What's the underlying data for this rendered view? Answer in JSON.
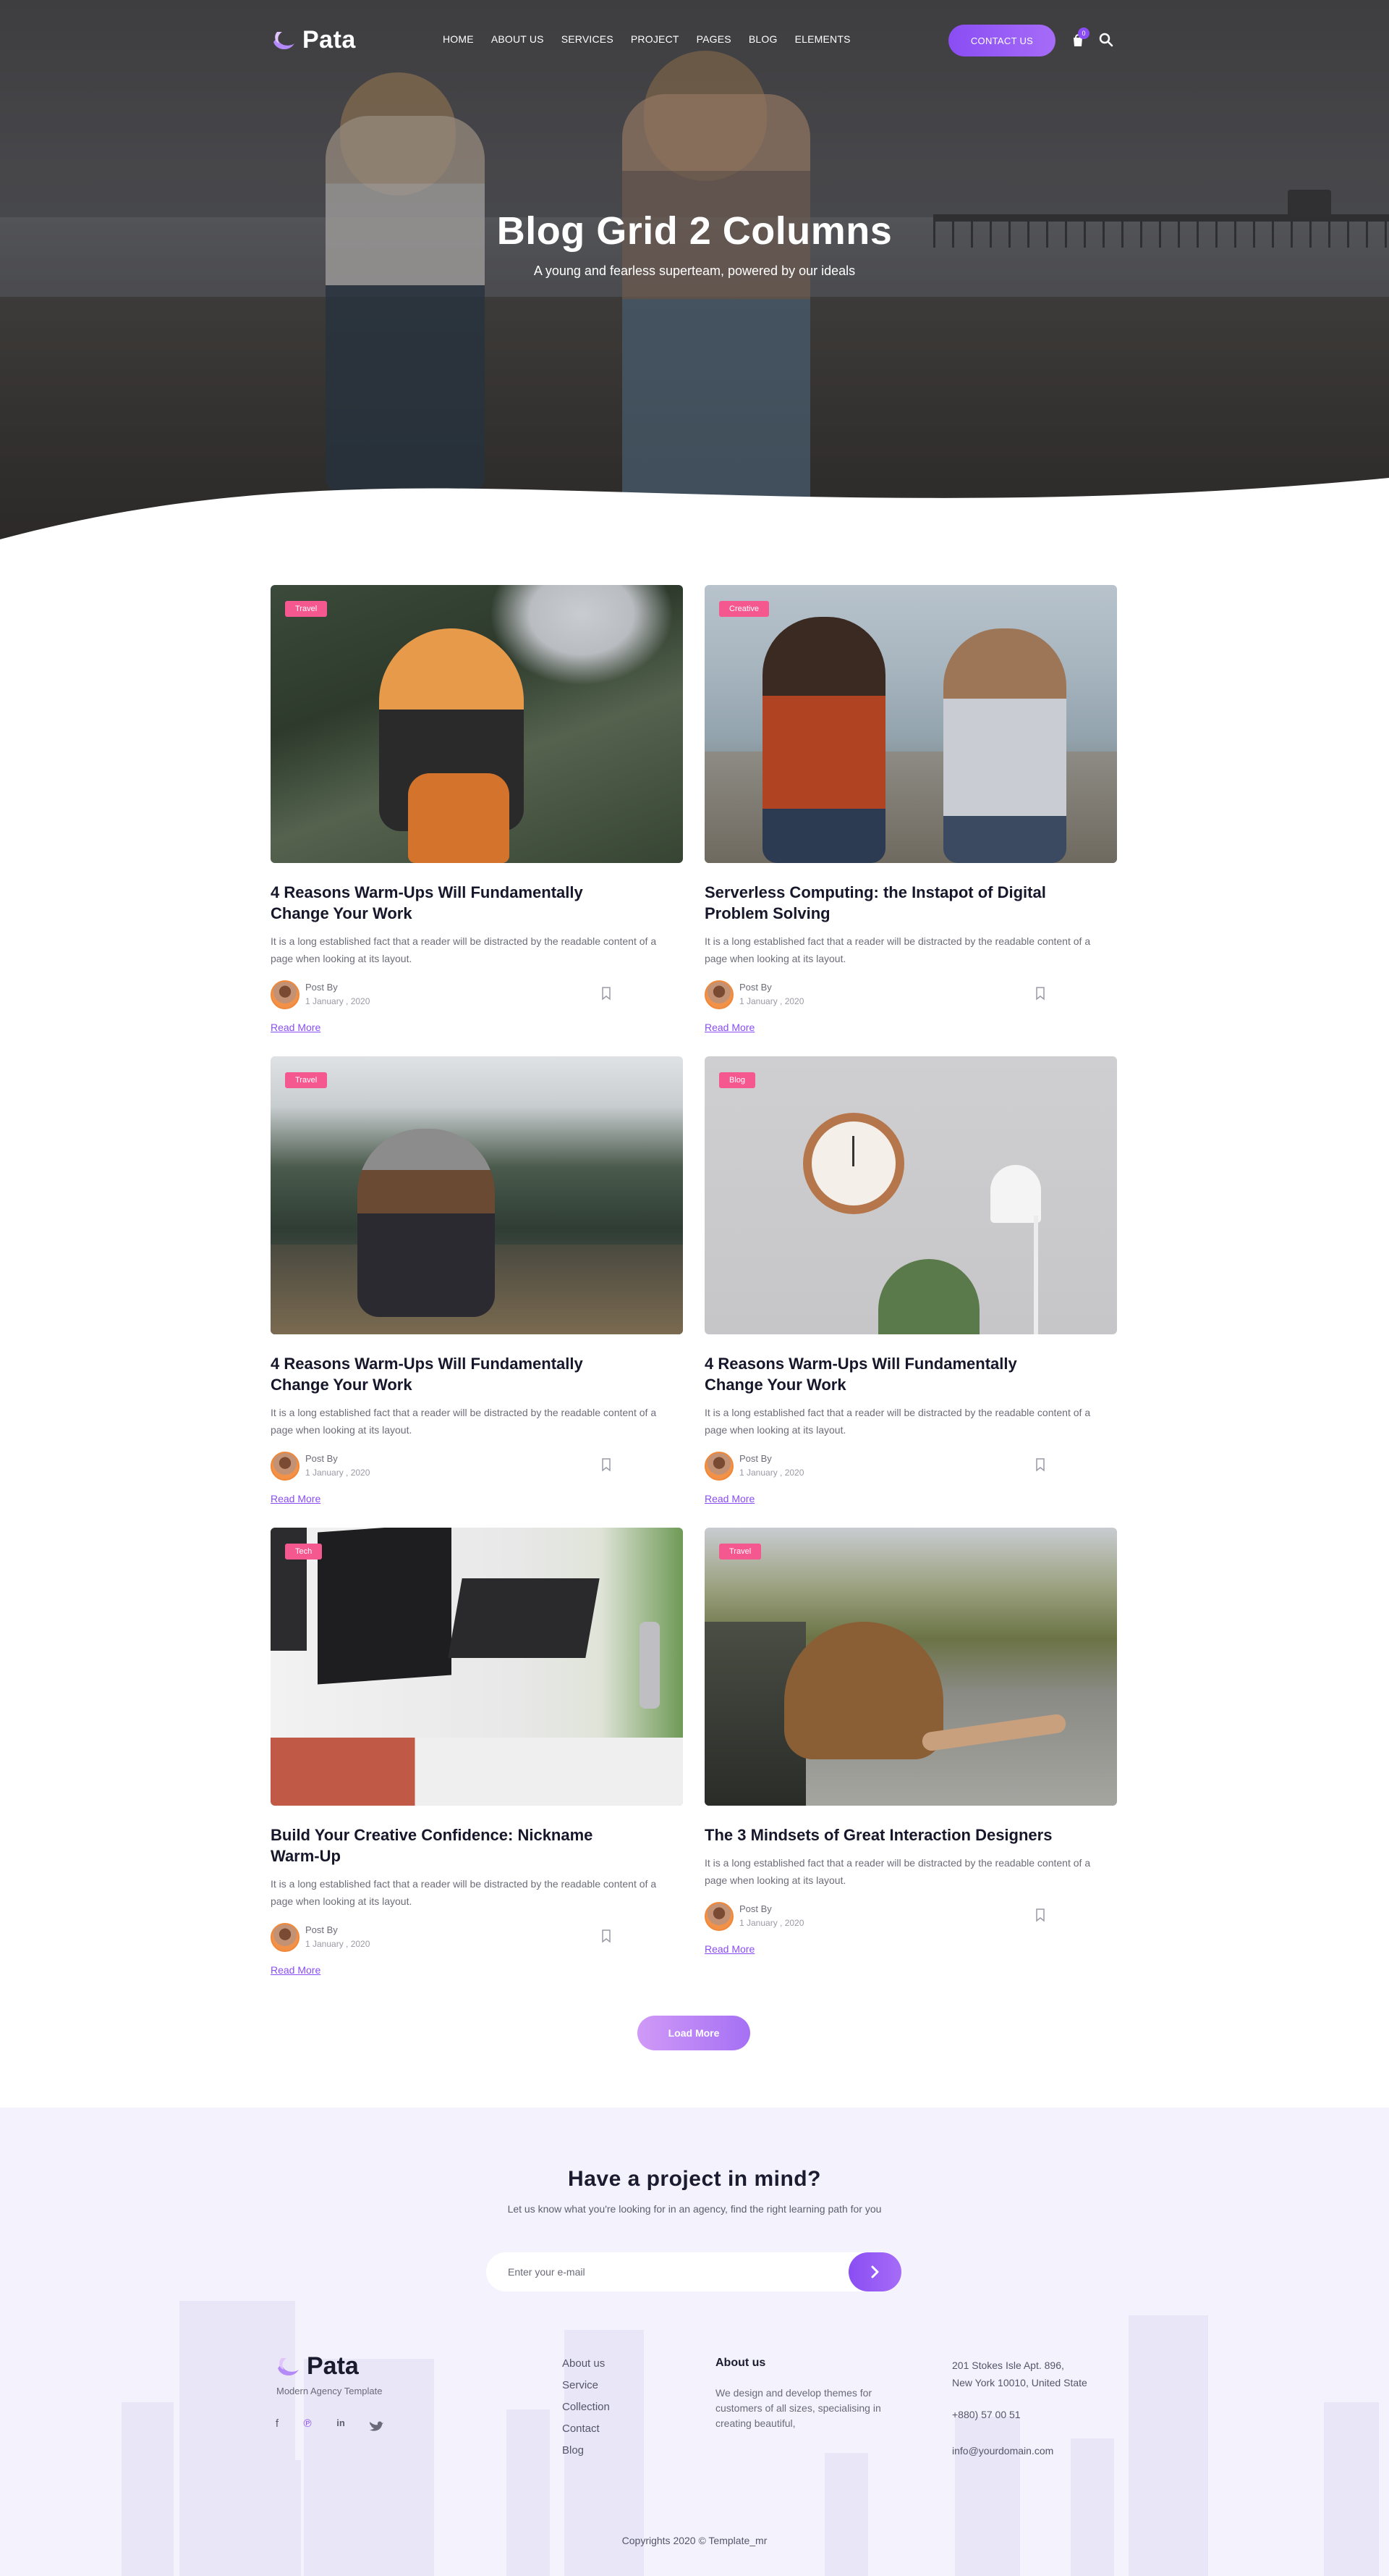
{
  "brand": {
    "name": "Pata",
    "tagline": "Modern Agency Template",
    "accent": "#8a4df4",
    "tag_color": "#f5588e"
  },
  "nav": {
    "items": [
      "HOME",
      "ABOUT US",
      "SERVICES",
      "PROJECT",
      "PAGES",
      "BLOG",
      "ELEMENTS"
    ],
    "contact_label": "CONTACT US",
    "cart_count": "0"
  },
  "hero": {
    "title": "Blog Grid 2 Columns",
    "subtitle": "A young and fearless superteam, powered by our ideals"
  },
  "posts": [
    {
      "tag": "Travel",
      "title": "4 Reasons Warm-Ups Will Fundamentally Change Your Work",
      "excerpt": "It is a long established fact that a reader will be distracted by the readable content of a page when looking at its layout.",
      "author_label": "Post By",
      "date": "1 January , 2020",
      "read_more": "Read More",
      "image": "woman-orange-backpack-forest"
    },
    {
      "tag": "Creative",
      "title": "Serverless Computing: the Instapot of Digital Problem Solving",
      "excerpt": "It is a long established fact that a reader will be distracted by the readable content of a page when looking at its layout.",
      "author_label": "Post By",
      "date": "1 January , 2020",
      "read_more": "Read More",
      "image": "two-women-by-lake"
    },
    {
      "tag": "Travel",
      "title": "4 Reasons Warm-Ups Will Fundamentally Change Your Work",
      "excerpt": "It is a long established fact that a reader will be distracted by the readable content of a page when looking at its layout.",
      "author_label": "Post By",
      "date": "1 January , 2020",
      "read_more": "Read More",
      "image": "woman-sitting-mountain-lake"
    },
    {
      "tag": "Blog",
      "title": "4 Reasons Warm-Ups Will Fundamentally Change Your Work",
      "excerpt": "It is a long established fact that a reader will be distracted by the readable content of a page when looking at its layout.",
      "author_label": "Post By",
      "date": "1 January , 2020",
      "read_more": "Read More",
      "image": "wall-clock-lamp-plant"
    },
    {
      "tag": "Tech",
      "title": "Build Your Creative Confidence: Nickname Warm-Up",
      "excerpt": "It is a long established fact that a reader will be distracted by the readable content of a page when looking at its layout.",
      "author_label": "Post By",
      "date": "1 January , 2020",
      "read_more": "Read More",
      "image": "monitors-laptop-desk"
    },
    {
      "tag": "Travel",
      "title": "The 3 Mindsets of Great Interaction Designers",
      "excerpt": "It is a long established fact that a reader will be distracted by the readable content of a page when looking at its layout.",
      "author_label": "Post By",
      "date": "1 January , 2020",
      "read_more": "Read More",
      "image": "woman-car-window-road"
    }
  ],
  "load_more": "Load More",
  "newsletter": {
    "title": "Have a project in mind?",
    "subtitle": "Let us know what you're looking for in an agency, find the right learning path for you",
    "placeholder": "Enter your e-mail"
  },
  "footer": {
    "links": [
      "About us",
      "Service",
      "Collection",
      "Contact",
      "Blog"
    ],
    "about_heading": "About us",
    "about_text": "We design and develop themes for customers of all sizes, specialising in creating beautiful,",
    "address_line1": "201 Stokes Isle Apt. 896,",
    "address_line2": "New York 10010, United State",
    "phone": "+880) 57 00 51",
    "email": "info@yourdomain.com",
    "social": [
      "facebook-icon",
      "pinterest-icon",
      "linkedin-icon",
      "twitter-icon"
    ],
    "copyright": "Copyrights 2020 © Template_mr"
  }
}
